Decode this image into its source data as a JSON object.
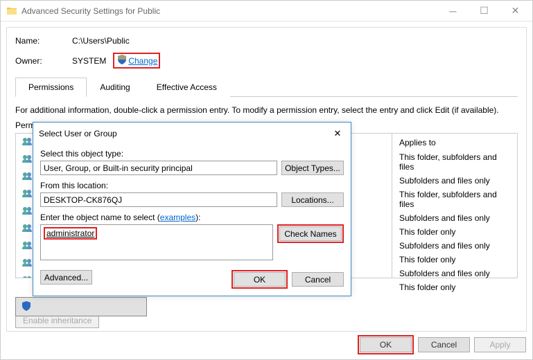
{
  "titlebar": {
    "title": "Advanced Security Settings for Public"
  },
  "header": {
    "name_label": "Name:",
    "name_value": "C:\\Users\\Public",
    "owner_label": "Owner:",
    "owner_value": "SYSTEM",
    "change_link": "Change"
  },
  "tabs": {
    "permissions": "Permissions",
    "auditing": "Auditing",
    "effective_access": "Effective Access"
  },
  "info_text": "For additional information, double-click a permission entry. To modify a permission entry, select the entry and click Edit (if available).",
  "perm_label": "Perm",
  "applies_to_header": "Applies to",
  "applies_to": [
    "This folder, subfolders and files",
    "Subfolders and files only",
    "This folder, subfolders and files",
    "Subfolders and files only",
    "This folder only",
    "Subfolders and files only",
    "This folder only",
    "Subfolders and files only",
    "This folder only"
  ],
  "bottom": {
    "enable_inheritance": "Enable inheritance",
    "ok": "OK",
    "cancel": "Cancel",
    "apply": "Apply"
  },
  "dialog": {
    "title": "Select User or Group",
    "object_type_label": "Select this object type:",
    "object_type_value": "User, Group, or Built-in security principal",
    "object_types_btn": "Object Types...",
    "location_label": "From this location:",
    "location_value": "DESKTOP-CK876QJ",
    "locations_btn": "Locations...",
    "enter_name_label_prefix": "Enter the object name to select (",
    "examples_link": "examples",
    "enter_name_label_suffix": "):",
    "entered_name": "administrator",
    "check_names_btn": "Check Names",
    "advanced_btn": "Advanced...",
    "ok": "OK",
    "cancel": "Cancel"
  }
}
